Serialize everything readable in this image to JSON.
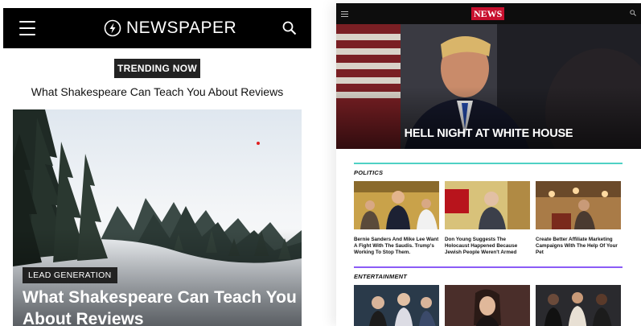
{
  "left_app": {
    "logo_text": "NEWSPAPER",
    "trending_badge": "TRENDING NOW",
    "trending_title": "What Shakespeare Can Teach You About Reviews",
    "hero": {
      "category": "LEAD GENERATION",
      "title": "What Shakespeare Can Teach You About Reviews"
    }
  },
  "right_app": {
    "logo_text": "NEWS",
    "hero_title": "HELL NIGHT AT WHITE HOUSE",
    "sections": [
      {
        "label": "POLITICS",
        "accent": "#4fd1c5",
        "cards": [
          {
            "title": "Bernie Sanders And Mike Lee Want A Fight With The Saudis. Trump's Working To Stop Them."
          },
          {
            "title": "Don Young Suggests The Holocaust Happened Because Jewish People Weren't Armed"
          },
          {
            "title": "Create Better Affiliate Marketing Campaigns With The Help Of Your Pet"
          }
        ]
      },
      {
        "label": "ENTERTAINMENT",
        "accent": "#8b5cf6",
        "cards": []
      }
    ]
  },
  "colors": {
    "header_black": "#000000",
    "news_red": "#c8102e",
    "politics_teal": "#4fd1c5",
    "entertainment_purple": "#8b5cf6"
  }
}
